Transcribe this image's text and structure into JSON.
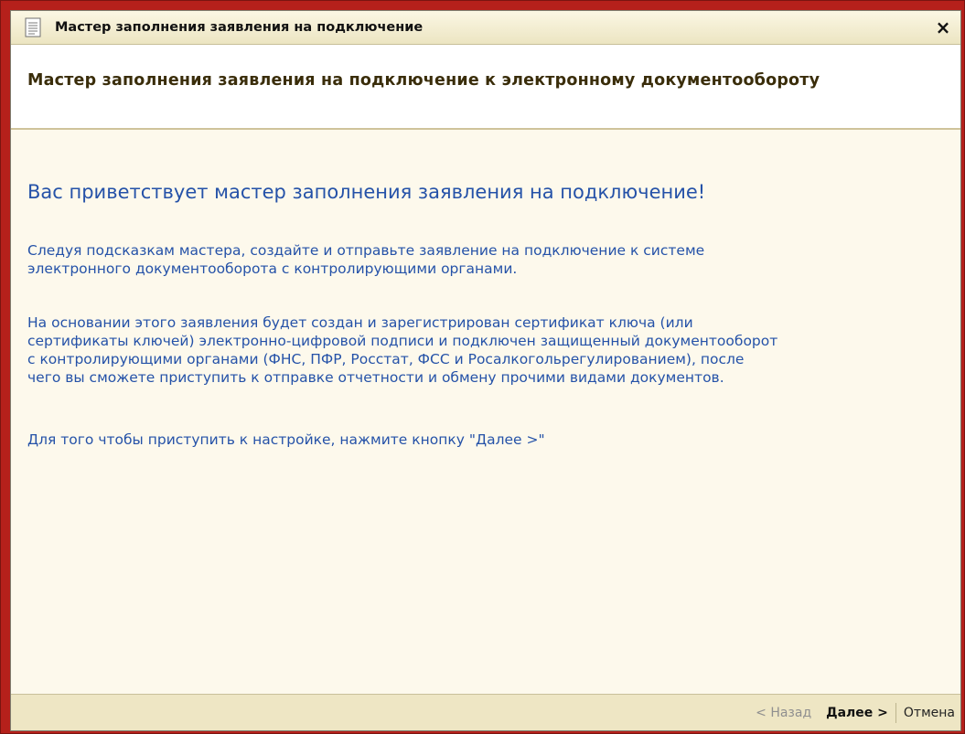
{
  "window": {
    "title": "Мастер заполнения заявления на подключение",
    "close_glyph": "×"
  },
  "header": {
    "title": "Мастер заполнения заявления на подключение к электронному документообороту"
  },
  "content": {
    "welcome": "Вас приветствует мастер заполнения заявления на подключение!",
    "paragraph1": [
      "Следуя подсказкам мастера, создайте и отправьте заявление на подключение к системе",
      "электронного документооборота с контролирующими органами."
    ],
    "paragraph2": [
      "На основании этого заявления будет создан и зарегистрирован сертификат ключа (или",
      "сертификаты ключей) электронно-цифровой подписи и подключен защищенный документооборот",
      "с контролирующими органами (ФНС, ПФР, Росстат, ФСС и Росалкогольрегулированием), после",
      "чего вы сможете приступить к отправке отчетности и обмену прочими видами документов."
    ],
    "paragraph3": "Для того чтобы приступить к настройке, нажмите кнопку \"Далее >\""
  },
  "footer": {
    "back_label": "< Назад",
    "next_label": "Далее >",
    "cancel_label": "Отмена"
  },
  "icons": {
    "window_icon": "document-icon",
    "close_icon": "close-icon"
  },
  "colors": {
    "frame": "#b5201b",
    "titlebar": "#ece5c2",
    "content_bg": "#fdf9ec",
    "text_blue": "#2552a8",
    "header_text": "#3a2d0a"
  }
}
